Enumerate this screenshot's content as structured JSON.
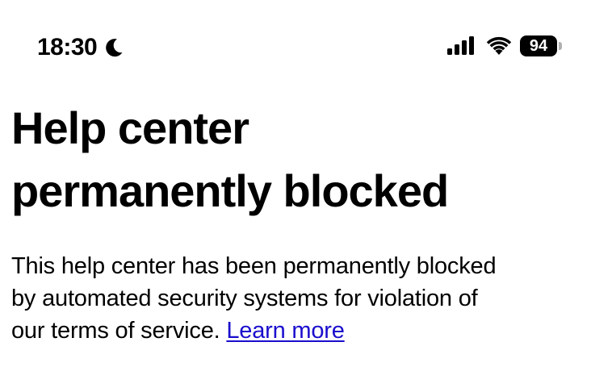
{
  "status_bar": {
    "time": "18:30",
    "moon_icon": "moon-icon",
    "signal_icon": "cellular-signal-icon",
    "wifi_icon": "wifi-icon",
    "battery_level": "94"
  },
  "page": {
    "title_line1": "Help center",
    "title_line2": "permanently blocked",
    "body_line1": "This help center has been permanently blocked",
    "body_line2": "by automated security systems for violation of",
    "body_line3_prefix": "our terms of service.",
    "learn_more_label": "Learn more"
  },
  "colors": {
    "link": "#1a0dcc",
    "text": "#000000",
    "background": "#ffffff"
  }
}
